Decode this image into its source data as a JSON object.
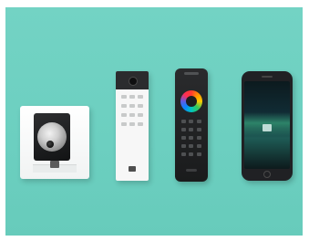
{
  "colors": {
    "background": "#6ccfc0",
    "device_dark": "#1f2022",
    "device_light": "#f7f7f7"
  },
  "devices": [
    {
      "name": "doorbell",
      "icon": "doorbell-camera-icon"
    },
    {
      "name": "keypad",
      "icon": "keypad-icon"
    },
    {
      "name": "remote",
      "icon": "remote-control-icon"
    },
    {
      "name": "phone",
      "icon": "smartphone-icon"
    }
  ]
}
